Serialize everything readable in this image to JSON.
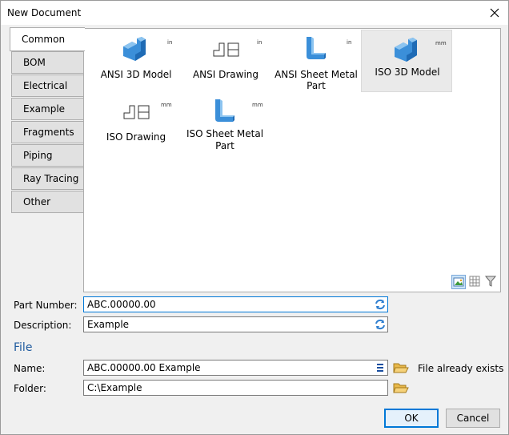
{
  "window": {
    "title": "New Document"
  },
  "tabs": [
    {
      "label": "Common",
      "active": true
    },
    {
      "label": "BOM"
    },
    {
      "label": "Electrical"
    },
    {
      "label": "Example"
    },
    {
      "label": "Fragments"
    },
    {
      "label": "Piping"
    },
    {
      "label": "Ray Tracing"
    },
    {
      "label": "Other"
    }
  ],
  "templates": [
    {
      "name": "ANSI 3D Model",
      "unit": "in",
      "icon": "3d-model-icon"
    },
    {
      "name": "ANSI Drawing",
      "unit": "in",
      "icon": "drawing-icon"
    },
    {
      "name": "ANSI Sheet Metal Part",
      "name_line1": "ANSI Sheet Metal",
      "name_line2": "Part",
      "unit": "in",
      "icon": "sheet-metal-icon"
    },
    {
      "name": "ISO 3D Model",
      "unit": "mm",
      "icon": "3d-model-icon",
      "selected": true
    },
    {
      "name": "ISO Drawing",
      "unit": "mm",
      "icon": "drawing-icon"
    },
    {
      "name": "ISO Sheet Metal Part",
      "name_line1": "ISO Sheet Metal",
      "name_line2": "Part",
      "unit": "mm",
      "icon": "sheet-metal-icon"
    }
  ],
  "form": {
    "part_number_label": "Part Number:",
    "part_number_value": "ABC.00000.00",
    "description_label": "Description:",
    "description_value": "Example",
    "file_section": "File",
    "name_label": "Name:",
    "name_value": "ABC.00000.00 Example",
    "folder_label": "Folder:",
    "folder_value": "C:\\Example",
    "status": "File already exists"
  },
  "buttons": {
    "ok": "OK",
    "cancel": "Cancel"
  },
  "colors": {
    "accent": "#0078d7",
    "icon_blue": "#3b8fd9",
    "section": "#1e5a9e"
  }
}
